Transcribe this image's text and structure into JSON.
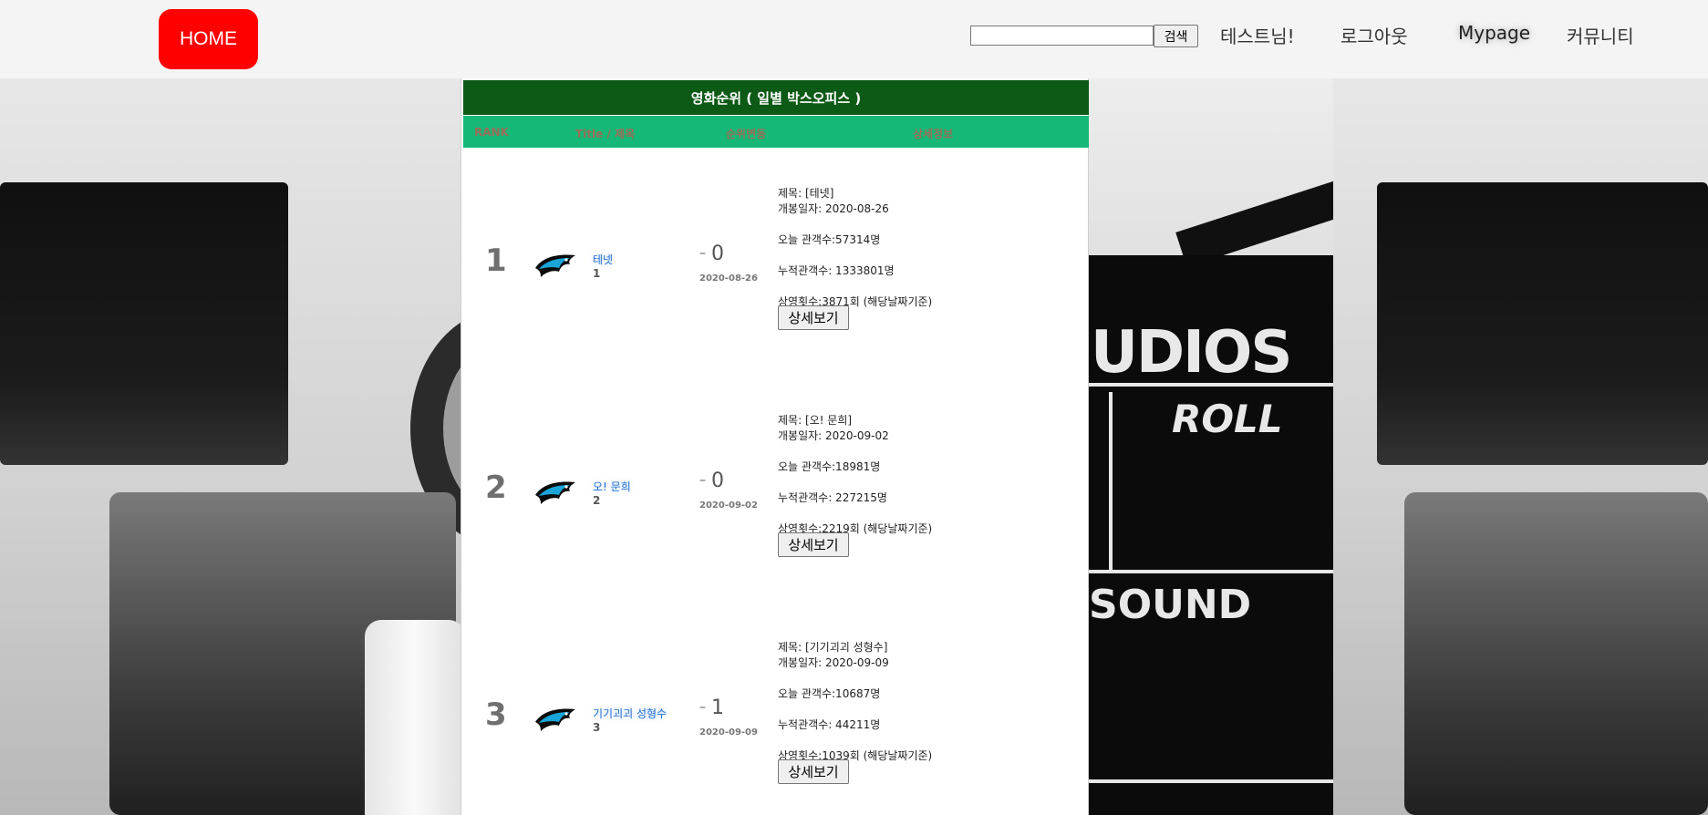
{
  "header": {
    "home_label": "HOME",
    "search_placeholder": "",
    "search_value": "",
    "search_button": "검색",
    "nav": {
      "user": "테스트님!",
      "logout": "로그아웃",
      "mypage": "Mypage",
      "community": "커뮤니티"
    }
  },
  "panel": {
    "title": "영화순위 ( 일별 박스오피스 )",
    "columns": {
      "rank": "RANK",
      "title": "Title / 제목",
      "change": "순위변동",
      "detail": "상세정보"
    }
  },
  "movies": [
    {
      "rank": "1",
      "title": "테넷",
      "sub_rank": "1",
      "change_dash": "–",
      "change_value": "0",
      "open_date": "2020-08-26",
      "detail_title": "제목: [테넷]",
      "detail_open": "개봉일자: 2020-08-26",
      "detail_today": "오늘 관객수:57314명",
      "detail_total": "누적관객수: 1333801명",
      "detail_shows": "상영횟수:3871회 (해당날짜기준)",
      "button": "상세보기"
    },
    {
      "rank": "2",
      "title": "오! 문희",
      "sub_rank": "2",
      "change_dash": "–",
      "change_value": "0",
      "open_date": "2020-09-02",
      "detail_title": "제목: [오! 문희]",
      "detail_open": "개봉일자: 2020-09-02",
      "detail_today": "오늘 관객수:18981명",
      "detail_total": "누적관객수: 227215명",
      "detail_shows": "상영횟수:2219회 (해당날짜기준)",
      "button": "상세보기"
    },
    {
      "rank": "3",
      "title": "기기괴괴 성형수",
      "sub_rank": "3",
      "change_dash": "–",
      "change_value": "1",
      "open_date": "2020-09-09",
      "detail_title": "제목: [기기괴괴 성형수]",
      "detail_open": "개봉일자: 2020-09-09",
      "detail_today": "오늘 관객수:10687명",
      "detail_total": "누적관객수: 44211명",
      "detail_shows": "상영횟수:1039회 (해당날짜기준)",
      "button": "상세보기"
    }
  ],
  "background": {
    "clapper_text_1": "UDIOS",
    "clapper_text_2": "ROLL",
    "clapper_text_3": "SOUND"
  },
  "colors": {
    "home_button": "#ff0000",
    "title_bar": "#0c5a16",
    "header_bar": "#15b877",
    "link": "#1f6fd1"
  },
  "icons": {
    "movie_logo": "panther-logo-icon"
  }
}
